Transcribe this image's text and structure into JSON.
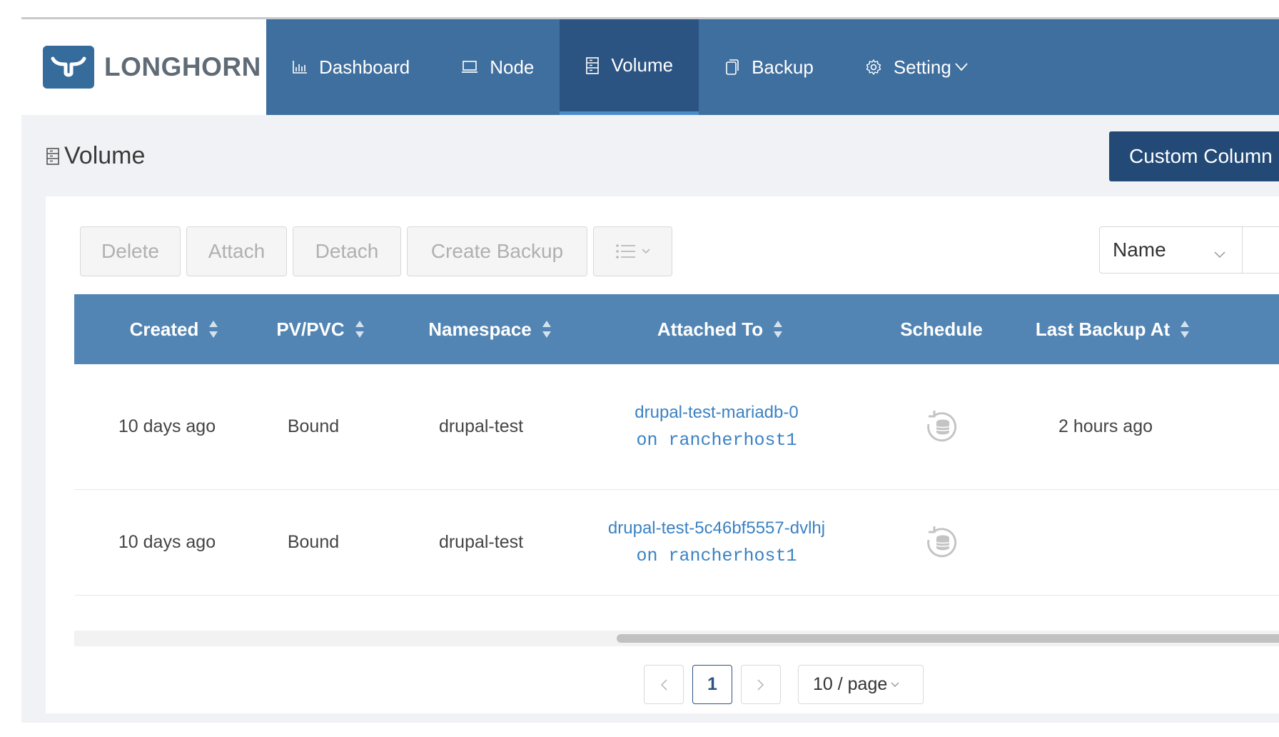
{
  "brand": {
    "name": "LONGHORN"
  },
  "nav": {
    "items": [
      {
        "label": "Dashboard",
        "icon": "bar-chart-icon"
      },
      {
        "label": "Node",
        "icon": "laptop-icon"
      },
      {
        "label": "Volume",
        "icon": "database-icon",
        "active": true
      },
      {
        "label": "Backup",
        "icon": "copy-icon"
      },
      {
        "label": "Setting",
        "icon": "gear-icon",
        "has_dropdown": true
      }
    ]
  },
  "page": {
    "title": "Volume",
    "custom_button": "Custom Column"
  },
  "toolbar": {
    "delete": "Delete",
    "attach": "Attach",
    "detach": "Detach",
    "create_backup": "Create Backup"
  },
  "search": {
    "field_value": "Name"
  },
  "table": {
    "columns": [
      "Created",
      "PV/PVC",
      "Namespace",
      "Attached To",
      "Schedule",
      "Last Backup At"
    ],
    "rows": [
      {
        "created": "10 days ago",
        "pvpvc": "Bound",
        "namespace": "drupal-test",
        "attached_pod": "drupal-test-mariadb-0",
        "attached_node": "on rancherhost1",
        "schedule_icon": "schedule-backup-icon",
        "last_backup": "2 hours ago"
      },
      {
        "created": "10 days ago",
        "pvpvc": "Bound",
        "namespace": "drupal-test",
        "attached_pod": "drupal-test-5c46bf5557-dvlhj",
        "attached_node": "on rancherhost1",
        "schedule_icon": "schedule-backup-icon",
        "last_backup": ""
      }
    ]
  },
  "pagination": {
    "current_page": "1",
    "page_size": "10 / page"
  },
  "colors": {
    "header": "#3f6f9e",
    "active_nav": "#2c5482",
    "table_header": "#5285b3",
    "link": "#3b82c4",
    "primary_button": "#234a77"
  }
}
